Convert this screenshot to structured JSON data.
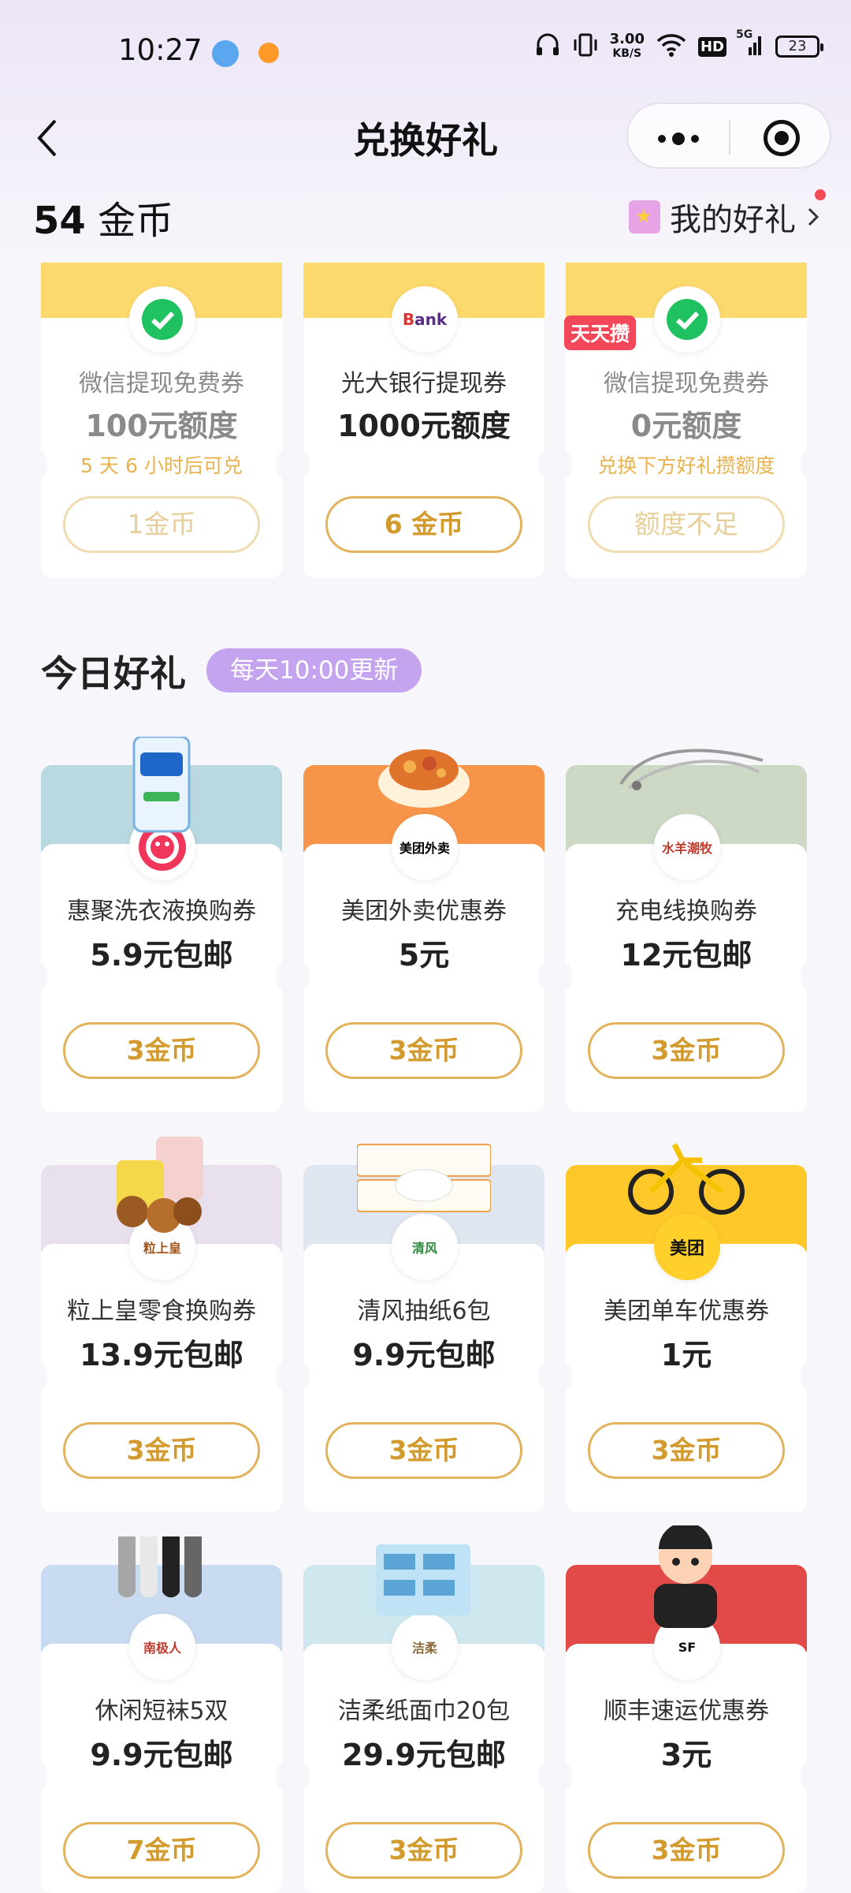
{
  "status": {
    "time": "10:27",
    "speed_value": "3.00",
    "speed_unit": "KB/S",
    "hd": "HD",
    "network": "5G",
    "battery": "23"
  },
  "nav": {
    "title": "兑换好礼"
  },
  "header": {
    "coin_count": "54",
    "coin_unit": "金币",
    "my_gifts": "我的好礼"
  },
  "top_cards": [
    {
      "name": "微信提现免费券",
      "amount": "100元额度",
      "note": "5 天 6 小时后可兑",
      "button": "1金币",
      "logo": "wechat"
    },
    {
      "name": "光大银行提现券",
      "amount": "1000元额度",
      "note": "",
      "button": "6 金币",
      "logo": "Bank"
    },
    {
      "name": "微信提现免费券",
      "amount": "0元额度",
      "note": "兑换下方好礼攒额度",
      "button": "额度不足",
      "tag": "天天攒",
      "logo": "wechat"
    }
  ],
  "section": {
    "title": "今日好礼",
    "badge": "每天10:00更新"
  },
  "gifts": [
    {
      "name": "惠聚洗衣液换购券",
      "price": "5.9元包邮",
      "button": "3金币",
      "logo": "",
      "band": "#b9d8df"
    },
    {
      "name": "美团外卖优惠券",
      "price": "5元",
      "button": "3金币",
      "logo": "美团外卖",
      "band": "#f6954a"
    },
    {
      "name": "充电线换购券",
      "price": "12元包邮",
      "button": "3金币",
      "logo": "水羊潮牧",
      "band": "#cdd9c5"
    },
    {
      "name": "粒上皇零食换购券",
      "price": "13.9元包邮",
      "button": "3金币",
      "logo": "粒上皇",
      "band": "#e9e0ee"
    },
    {
      "name": "清风抽纸6包",
      "price": "9.9元包邮",
      "button": "3金币",
      "logo": "清风",
      "band": "#dfe6ef"
    },
    {
      "name": "美团单车优惠券",
      "price": "1元",
      "button": "3金币",
      "logo": "美团",
      "band": "#ffc82a"
    },
    {
      "name": "休闲短袜5双",
      "price": "9.9元包邮",
      "button": "7金币",
      "logo": "南极人",
      "band": "#c9dbf0"
    },
    {
      "name": "洁柔纸面巾20包",
      "price": "29.9元包邮",
      "button": "3金币",
      "logo": "洁柔",
      "band": "#cfe7ef"
    },
    {
      "name": "顺丰速运优惠券",
      "price": "3元",
      "button": "3金币",
      "logo": "SF",
      "band": "#e24a48"
    }
  ]
}
